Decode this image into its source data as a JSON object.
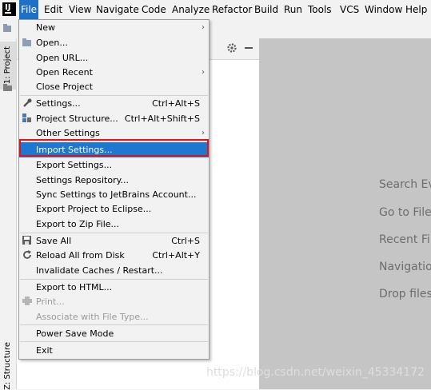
{
  "menubar": {
    "items": [
      "File",
      "Edit",
      "View",
      "Navigate",
      "Code",
      "Analyze",
      "Refactor",
      "Build",
      "Run",
      "Tools",
      "VCS",
      "Window",
      "Help"
    ]
  },
  "left_stripe": {
    "project_tab": "1: Project",
    "structure_tab": "Z: Structure"
  },
  "file_menu": {
    "items": [
      {
        "label": "New",
        "shortcut": "",
        "submenu": true
      },
      {
        "label": "Open...",
        "shortcut": "",
        "submenu": false,
        "icon": "folder-open-icon"
      },
      {
        "label": "Open URL...",
        "shortcut": "",
        "submenu": false
      },
      {
        "label": "Open Recent",
        "shortcut": "",
        "submenu": true
      },
      {
        "label": "Close Project",
        "shortcut": "",
        "submenu": false
      },
      {
        "label": "Settings...",
        "shortcut": "Ctrl+Alt+S",
        "submenu": false,
        "icon": "wrench-icon"
      },
      {
        "label": "Project Structure...",
        "shortcut": "Ctrl+Alt+Shift+S",
        "submenu": false,
        "icon": "project-structure-icon"
      },
      {
        "label": "Other Settings",
        "shortcut": "",
        "submenu": true
      },
      {
        "label": "Import Settings...",
        "shortcut": "",
        "submenu": false,
        "selected": true
      },
      {
        "label": "Export Settings...",
        "shortcut": "",
        "submenu": false
      },
      {
        "label": "Settings Repository...",
        "shortcut": "",
        "submenu": false
      },
      {
        "label": "Sync Settings to JetBrains Account...",
        "shortcut": "",
        "submenu": false
      },
      {
        "label": "Export Project to Eclipse...",
        "shortcut": "",
        "submenu": false
      },
      {
        "label": "Export to Zip File...",
        "shortcut": "",
        "submenu": false
      },
      {
        "label": "Save All",
        "shortcut": "Ctrl+S",
        "submenu": false,
        "icon": "save-icon"
      },
      {
        "label": "Reload All from Disk",
        "shortcut": "Ctrl+Alt+Y",
        "submenu": false,
        "icon": "reload-icon"
      },
      {
        "label": "Invalidate Caches / Restart...",
        "shortcut": "",
        "submenu": false
      },
      {
        "label": "Export to HTML...",
        "shortcut": "",
        "submenu": false
      },
      {
        "label": "Print...",
        "shortcut": "",
        "submenu": false,
        "disabled": true,
        "icon": "print-icon"
      },
      {
        "label": "Associate with File Type...",
        "shortcut": "",
        "submenu": false,
        "disabled": true
      },
      {
        "label": "Power Save Mode",
        "shortcut": "",
        "submenu": false
      },
      {
        "label": "Exit",
        "shortcut": "",
        "submenu": false
      }
    ]
  },
  "editor_hints": [
    "Search Ev",
    "Go to File",
    "Recent Fil",
    "Navigatio",
    "Drop files"
  ],
  "watermark": "https://blog.csdn.net/weixin_45334172",
  "colors": {
    "selection": "#1e78cf",
    "highlight_border": "#e0141e"
  }
}
